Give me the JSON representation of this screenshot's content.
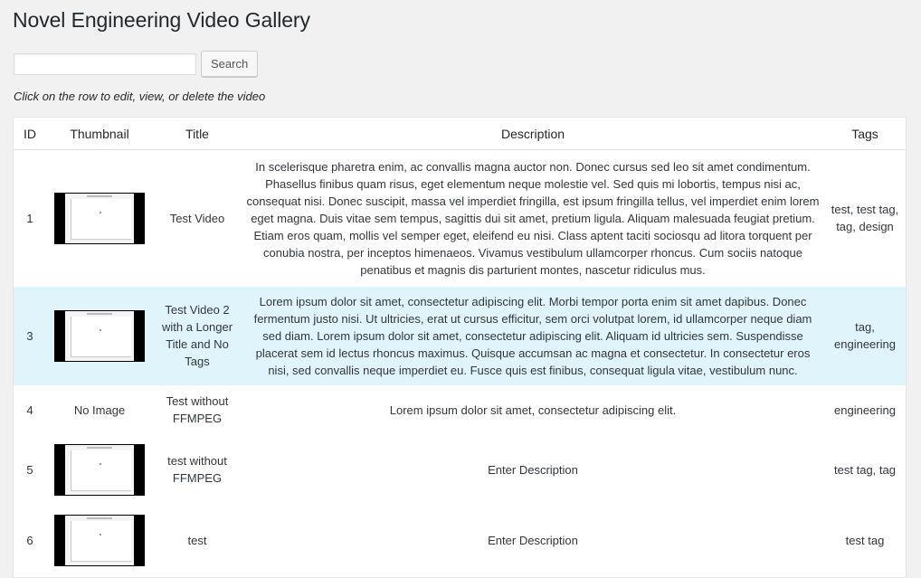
{
  "page": {
    "title": "Novel Engineering Video Gallery",
    "hint": "Click on the row to edit, view, or delete the video"
  },
  "search": {
    "value": "",
    "placeholder": "",
    "button_label": "Search"
  },
  "table": {
    "headers": {
      "id": "ID",
      "thumbnail": "Thumbnail",
      "title": "Title",
      "description": "Description",
      "tags": "Tags"
    },
    "rows": [
      {
        "id": "1",
        "thumbnail": "image",
        "title": "Test Video",
        "description": "In scelerisque pharetra enim, ac convallis magna auctor non. Donec cursus sed leo sit amet condimentum. Phasellus finibus quam risus, eget elementum neque molestie vel. Sed quis mi lobortis, tempus nisi ac, consequat nisi. Donec suscipit, massa vel imperdiet fringilla, est ipsum fringilla tellus, vel imperdiet enim lorem eget magna. Duis vitae sem tempus, sagittis dui sit amet, pretium ligula. Aliquam malesuada feugiat pretium. Etiam eros quam, mollis vel semper eget, eleifend eu nisi. Class aptent taciti sociosqu ad litora torquent per conubia nostra, per inceptos himenaeos. Vivamus vestibulum ullamcorper rhoncus. Cum sociis natoque penatibus et magnis dis parturient montes, nascetur ridiculus mus.",
        "tags": "test, test tag, tag, design"
      },
      {
        "id": "3",
        "thumbnail": "image",
        "title": "Test Video 2 with a Longer Title and No Tags",
        "description": "Lorem ipsum dolor sit amet, consectetur adipiscing elit. Morbi tempor porta enim sit amet dapibus. Donec fermentum justo nisi. Ut ultricies, erat ut cursus efficitur, sem orci volutpat lorem, id ullamcorper neque diam sed diam. Lorem ipsum dolor sit amet, consectetur adipiscing elit. Aliquam id ultricies sem. Suspendisse placerat sem id lectus rhoncus maximus. Quisque accumsan ac magna et consectetur. In consectetur eros nisi, sed convallis neque imperdiet eu. Fusce quis est finibus, consequat ligula vitae, vestibulum nunc.",
        "tags": "tag, engineering"
      },
      {
        "id": "4",
        "thumbnail": "No Image",
        "title": "Test without FFMPEG",
        "description": "Lorem ipsum dolor sit amet, consectetur adipiscing elit.",
        "tags": "engineering"
      },
      {
        "id": "5",
        "thumbnail": "image",
        "title": "test without FFMPEG",
        "description": "Enter Description",
        "tags": "test tag, tag"
      },
      {
        "id": "6",
        "thumbnail": "image",
        "title": "test",
        "description": "Enter Description",
        "tags": "test tag"
      }
    ]
  },
  "colors": {
    "page_background": "#f1f1f1",
    "row_highlight": "#e0f4fb"
  }
}
